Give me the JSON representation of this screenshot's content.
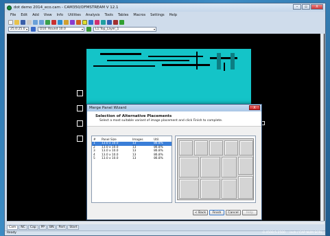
{
  "window": {
    "title": "dot demo 2014_eco.cam - CAM350/DFMSTREAM V 12.1",
    "controls": [
      "–",
      "▫",
      "X"
    ]
  },
  "menu": [
    "File",
    "Edit",
    "Add",
    "View",
    "Info",
    "Utilities",
    "Analysis",
    "Tools",
    "Tables",
    "Macros",
    "Settings",
    "Help"
  ],
  "toolbar2": {
    "size_value": "25.0:25.0",
    "aperture_value": "D10: Round 10.0",
    "layer_value": "L1:Top_Layer_1"
  },
  "dialog": {
    "title": "Merge Panel Wizard",
    "heading": "Selection of Alternative Placements",
    "subheading": "Select a most suitable variant of image placement and click Finish to complete.",
    "columns": [
      "#",
      "Panel Size",
      "Images",
      "Util."
    ],
    "rows": [
      [
        "1",
        "13.0 x 10.0",
        "13",
        "86.8%"
      ],
      [
        "2",
        "13.0 x 10.0",
        "13",
        "86.8%"
      ],
      [
        "3",
        "13.0 x 10.0",
        "13",
        "86.8%"
      ],
      [
        "4",
        "13.0 x 10.0",
        "13",
        "86.8%"
      ],
      [
        "5",
        "13.0 x 10.0",
        "13",
        "86.8%"
      ]
    ],
    "selected_row": 1,
    "buttons": {
      "back": "< Back",
      "finish": "Finish",
      "cancel": "Cancel",
      "help": "Help"
    }
  },
  "tabs": [
    "Cam",
    "NC",
    "Cap",
    "PP",
    "BN",
    "Part",
    "Start"
  ],
  "status": {
    "left": "Ready",
    "coords": "-0.4500;5.2500",
    "units": "inch / CAP NUM SCRL"
  },
  "colors": {
    "pcb": "#14c4c8",
    "canvas": "#000000",
    "selection": "#3a7ed8"
  }
}
